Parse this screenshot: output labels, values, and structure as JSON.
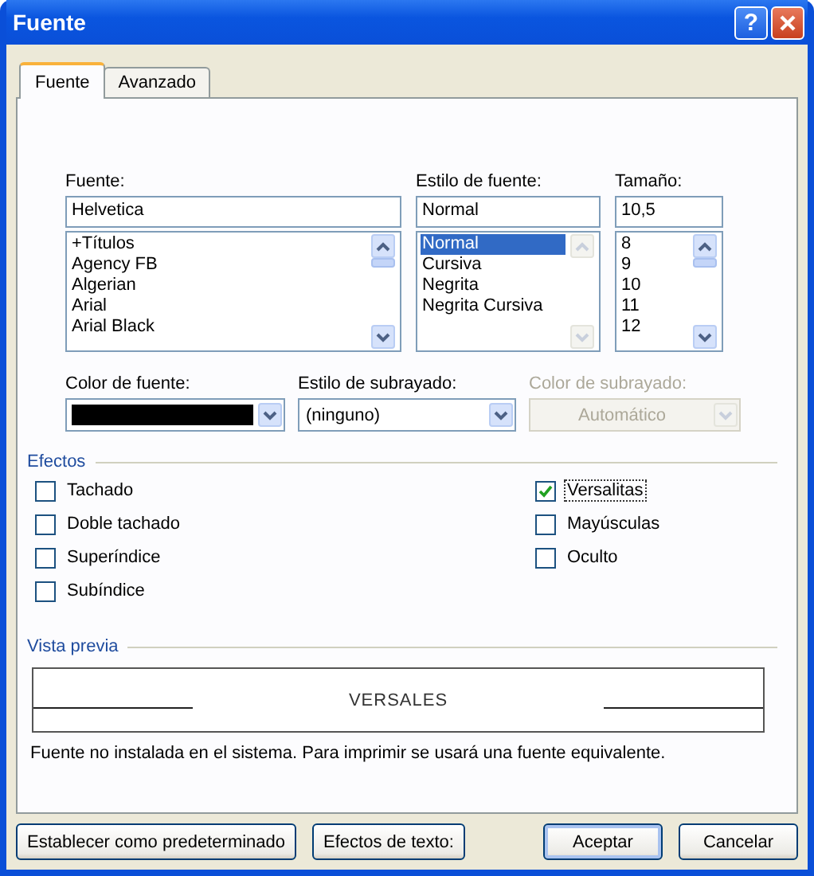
{
  "window": {
    "title": "Fuente",
    "help_button": "?"
  },
  "tabs": [
    {
      "label": "Fuente",
      "selected": true
    },
    {
      "label": "Avanzado",
      "selected": false
    }
  ],
  "font_columns": [
    {
      "label": "Fuente:",
      "value": "Helvetica",
      "scroll_disabled": false,
      "items": [
        {
          "text": "+Títulos",
          "selected": false
        },
        {
          "text": "Agency FB",
          "selected": false
        },
        {
          "text": "Algerian",
          "selected": false
        },
        {
          "text": "Arial",
          "selected": false
        },
        {
          "text": "Arial Black",
          "selected": false
        }
      ]
    },
    {
      "label": "Estilo de fuente:",
      "value": "Normal",
      "scroll_disabled": true,
      "items": [
        {
          "text": "Normal",
          "selected": true
        },
        {
          "text": "Cursiva",
          "selected": false
        },
        {
          "text": "Negrita",
          "selected": false
        },
        {
          "text": "Negrita Cursiva",
          "selected": false
        }
      ]
    },
    {
      "label": "Tamaño:",
      "value": "10,5",
      "scroll_disabled": false,
      "items": [
        {
          "text": "8",
          "selected": false
        },
        {
          "text": "9",
          "selected": false
        },
        {
          "text": "10",
          "selected": false
        },
        {
          "text": "11",
          "selected": false
        },
        {
          "text": "12",
          "selected": false
        }
      ]
    }
  ],
  "dropdowns": [
    {
      "label": "Color de fuente:",
      "kind": "swatch",
      "color": "#000000",
      "disabled": false
    },
    {
      "label": "Estilo de subrayado:",
      "kind": "text",
      "value": "(ninguno)",
      "disabled": false
    },
    {
      "label": "Color de subrayado:",
      "kind": "text",
      "value": "Automático",
      "disabled": true
    }
  ],
  "effects": {
    "label": "Efectos",
    "columns": [
      [
        {
          "label": "Tachado",
          "checked": false,
          "focused": false
        },
        {
          "label": "Doble tachado",
          "checked": false,
          "focused": false
        },
        {
          "label": "Superíndice",
          "checked": false,
          "focused": false
        },
        {
          "label": "Subíndice",
          "checked": false,
          "focused": false
        }
      ],
      [
        {
          "label": "Versalitas",
          "checked": true,
          "focused": true
        },
        {
          "label": "Mayúsculas",
          "checked": false,
          "focused": false
        },
        {
          "label": "Oculto",
          "checked": false,
          "focused": false
        }
      ]
    ]
  },
  "preview": {
    "label": "Vista previa",
    "sample": "VERSALES",
    "note": "Fuente no instalada en el sistema. Para imprimir se usará una fuente equivalente."
  },
  "buttons": [
    {
      "label": "Establecer como predeterminado",
      "default": false
    },
    {
      "label": "Efectos de texto:",
      "default": false
    },
    {
      "label": "Aceptar",
      "default": true
    },
    {
      "label": "Cancelar",
      "default": false
    }
  ]
}
